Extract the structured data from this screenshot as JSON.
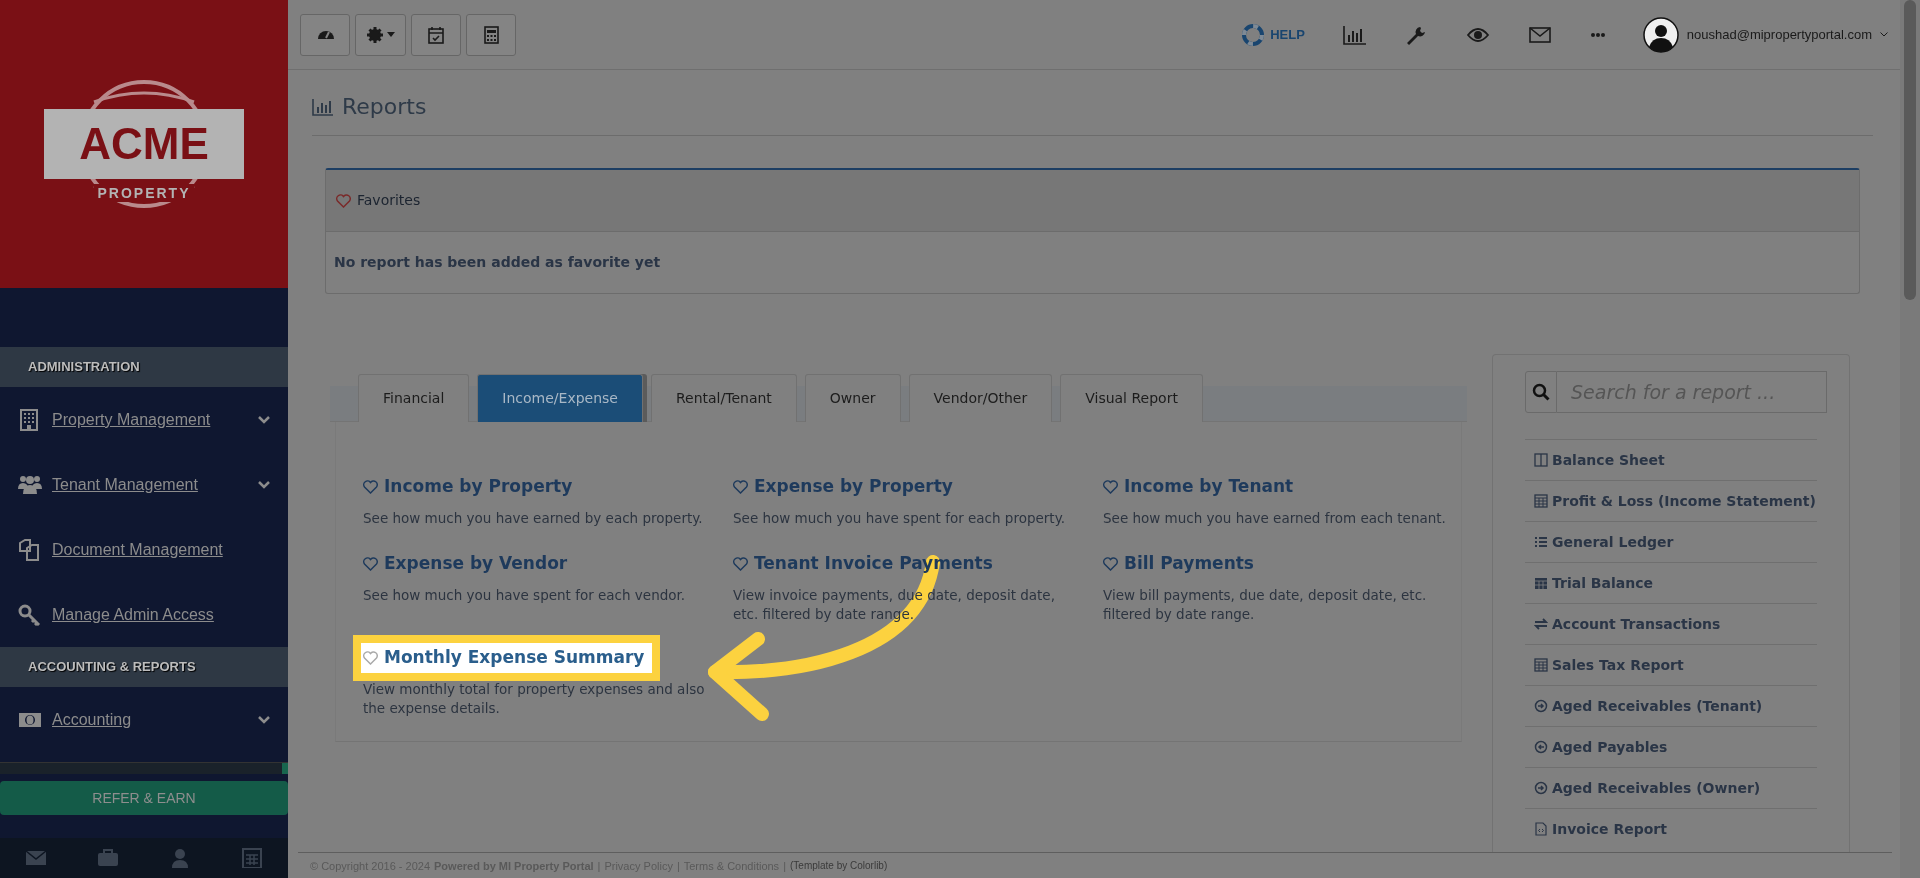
{
  "logo": {
    "wordmark": "ACME",
    "tagline": "PROPERTY"
  },
  "sidebar": {
    "sections": [
      {
        "heading": "ADMINISTRATION",
        "items": [
          {
            "label": "Property Management",
            "expandable": true
          },
          {
            "label": "Tenant Management",
            "expandable": true
          },
          {
            "label": "Document Management",
            "expandable": false
          },
          {
            "label": "Manage Admin Access",
            "expandable": false
          }
        ]
      },
      {
        "heading": "ACCOUNTING & REPORTS",
        "items": [
          {
            "label": "Accounting",
            "expandable": true
          }
        ]
      }
    ],
    "refer_button": "REFER & EARN"
  },
  "top_nav": {
    "help": "HELP",
    "user_email": "noushad@mipropertyportal.com"
  },
  "page_title": "Reports",
  "favorites": {
    "title": "Favorites",
    "empty_message": "No report has been added as favorite yet"
  },
  "tabs": [
    {
      "label": "Financial",
      "selected": false
    },
    {
      "label": "Income/Expense",
      "selected": true
    },
    {
      "label": "Rental/Tenant",
      "selected": false
    },
    {
      "label": "Owner",
      "selected": false
    },
    {
      "label": "Vendor/Other",
      "selected": false
    },
    {
      "label": "Visual Report",
      "selected": false
    }
  ],
  "reports": [
    {
      "title": "Income by Property",
      "description": "See how much you have earned by each property.",
      "highlighted": false
    },
    {
      "title": "Expense by Property",
      "description": "See how much you have spent for each property.",
      "highlighted": false
    },
    {
      "title": "Income by Tenant",
      "description": "See how much you have earned from each tenant.",
      "highlighted": false
    },
    {
      "title": "Expense by Vendor",
      "description": "See how much you have spent for each vendor.",
      "highlighted": false
    },
    {
      "title": "Tenant Invoice Payments",
      "description": "View invoice payments, due date, deposit date, etc. filtered by date range.",
      "highlighted": false
    },
    {
      "title": "Bill Payments",
      "description": "View bill payments, due date, deposit date, etc. filtered by date range.",
      "highlighted": false
    },
    {
      "title": "Monthly Expense Summary",
      "description": "View monthly total for property expenses and also the expense details.",
      "highlighted": true
    }
  ],
  "search": {
    "placeholder": "Search for a report ..."
  },
  "quick_reports": [
    "Balance Sheet",
    "Profit & Loss (Income Statement)",
    "General Ledger",
    "Trial Balance",
    "Account Transactions",
    "Sales Tax Report",
    "Aged Receivables (Tenant)",
    "Aged Payables",
    "Aged Receivables (Owner)",
    "Invoice Report"
  ],
  "footer": {
    "copyright": "© Copyright 2016 - 2024",
    "powered_by": "Powered by MI Property Portal",
    "links": [
      "Privacy Policy",
      "Terms & Conditions"
    ],
    "separators": [
      "|",
      "|",
      "|"
    ],
    "template_note": "(Template by Colorlib)"
  }
}
